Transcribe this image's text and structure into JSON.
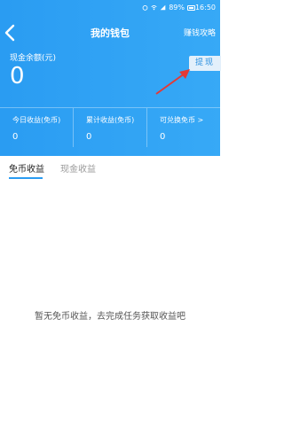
{
  "status": {
    "battery": "89%",
    "time": "16:50"
  },
  "nav": {
    "title": "我的钱包",
    "right": "赚钱攻略"
  },
  "balance": {
    "label": "现金余额(元)",
    "value": "0",
    "withdraw": "提现"
  },
  "stats": [
    {
      "label": "今日收益(免币)",
      "value": "0"
    },
    {
      "label": "累计收益(免币)",
      "value": "0"
    },
    {
      "label": "可兑换免币 >",
      "value": "0"
    }
  ],
  "tabs": {
    "active": "免币收益",
    "inactive": "现金收益"
  },
  "empty_message": "暂无免币收益，去完成任务获取收益吧",
  "colors": {
    "header": "#2a9cf2",
    "accent_arrow": "#e53935",
    "tab_underline": "#2a9cf2"
  }
}
